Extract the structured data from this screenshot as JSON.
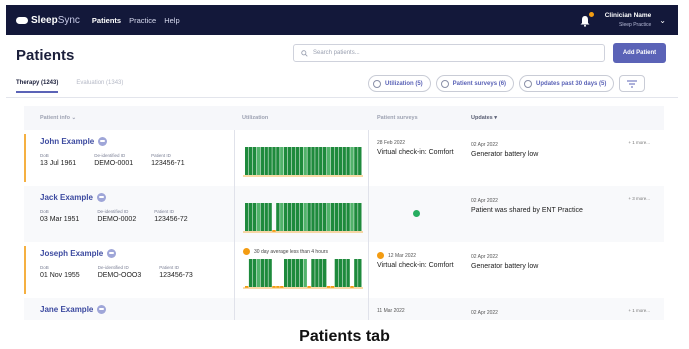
{
  "app": {
    "logo_bold": "Sleep",
    "logo_rest": "Sync"
  },
  "nav": [
    {
      "label": "Patients",
      "active": true
    },
    {
      "label": "Practice",
      "active": false
    },
    {
      "label": "Help",
      "active": false
    }
  ],
  "user": {
    "name": "Clinician Name",
    "practice": "Sleep Practice"
  },
  "page": {
    "title": "Patients",
    "add_label": "Add Patient"
  },
  "search": {
    "placeholder": "Search patients..."
  },
  "tabs": [
    {
      "label": "Therapy (1243)",
      "active": true
    },
    {
      "label": "Evaluation (1343)",
      "active": false
    }
  ],
  "filters": [
    {
      "label": "Utilization (5)"
    },
    {
      "label": "Patient surveys (6)"
    },
    {
      "label": "Updates past 30 days (5)"
    }
  ],
  "table": {
    "headers": {
      "info": "Patient info",
      "utilization": "Utilization",
      "surveys": "Patient surveys",
      "updates": "Updates"
    },
    "meta_labels": {
      "dob": "DoB",
      "deid": "De-identified ID",
      "pid": "Patient ID"
    },
    "rows": [
      {
        "name": "John Example",
        "dob": "13 Jul 1961",
        "deid": "DEMO-0001",
        "pid": "123456-71",
        "flag": true,
        "util_note": "",
        "survey_date": "28 Feb 2022",
        "survey_text": "Virtual check-in: Comfort",
        "survey_ok": false,
        "update_date": "02 Apr 2022",
        "update_text": "Generator battery low",
        "more": "+ 1 more..."
      },
      {
        "name": "Jack Example",
        "dob": "03 Mar 1951",
        "deid": "DEMO-0002",
        "pid": "123456-72",
        "flag": false,
        "util_note": "",
        "survey_date": "",
        "survey_text": "",
        "survey_ok": true,
        "update_date": "02 Apr 2022",
        "update_text": "Patient was shared by ENT Practice",
        "more": "+ 3 more..."
      },
      {
        "name": "Joseph Example",
        "dob": "01 Nov 1955",
        "deid": "DEMO-OOO3",
        "pid": "123456-73",
        "flag": true,
        "util_note": "30 day average less than 4 hours",
        "survey_date": "12 Mar 2022",
        "survey_text": "Virtual check-in: Comfort",
        "survey_ok": false,
        "update_date": "02 Apr 2022",
        "update_text": "Generator battery low",
        "more": ""
      },
      {
        "name": "Jane Example",
        "dob": "",
        "deid": "",
        "pid": "",
        "flag": false,
        "util_note": "",
        "survey_date": "11 Mar 2022",
        "survey_text": "",
        "survey_ok": false,
        "update_date": "02 Apr 2022",
        "update_text": "",
        "more": "+ 1 more..."
      }
    ]
  },
  "caption": "Patients tab",
  "colors": {
    "accent": "#5b63b7",
    "navbar": "#13183a",
    "warning": "#f39c12",
    "green": "#1e8a3c"
  }
}
